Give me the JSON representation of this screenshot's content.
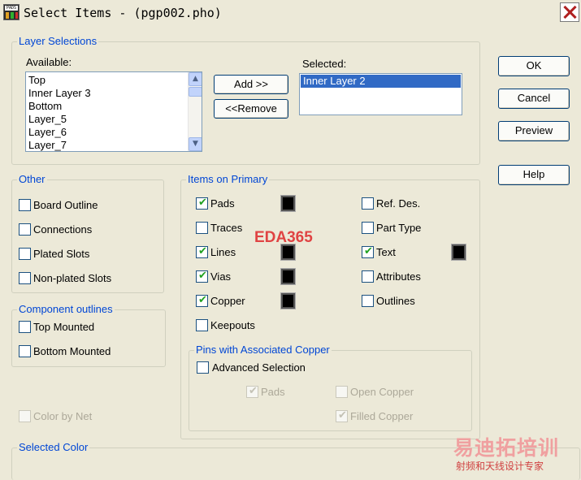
{
  "window": {
    "title": "Select Items - (pgp002.pho)"
  },
  "layer_selections": {
    "title": "Layer Selections",
    "available_label": "Available:",
    "available_items": [
      "Top",
      "Inner Layer 3",
      "Bottom",
      "Layer_5",
      "Layer_6",
      "Layer_7"
    ],
    "selected_label": "Selected:",
    "selected_items": [
      "Inner Layer 2"
    ],
    "add_button": "Add >>",
    "remove_button": "<<Remove"
  },
  "buttons": {
    "ok": "OK",
    "cancel": "Cancel",
    "preview": "Preview",
    "help": "Help"
  },
  "other": {
    "title": "Other",
    "items": [
      {
        "label": "Board Outline",
        "checked": false
      },
      {
        "label": "Connections",
        "checked": false
      },
      {
        "label": "Plated Slots",
        "checked": false
      },
      {
        "label": "Non-plated Slots",
        "checked": false
      }
    ]
  },
  "component_outlines": {
    "title": "Component outlines",
    "items": [
      {
        "label": "Top Mounted",
        "checked": false
      },
      {
        "label": "Bottom Mounted",
        "checked": false
      }
    ]
  },
  "color_by_net": {
    "label": "Color by Net",
    "checked": false,
    "enabled": false
  },
  "items_on_primary": {
    "title": "Items on Primary",
    "left": [
      {
        "label": "Pads",
        "checked": true,
        "color": "#000000"
      },
      {
        "label": "Traces",
        "checked": false
      },
      {
        "label": "Lines",
        "checked": true,
        "color": "#000000"
      },
      {
        "label": "Vias",
        "checked": true,
        "color": "#000000"
      },
      {
        "label": "Copper",
        "checked": true,
        "color": "#000000"
      },
      {
        "label": "Keepouts",
        "checked": false
      }
    ],
    "right": [
      {
        "label": "Ref. Des.",
        "checked": false
      },
      {
        "label": "Part Type",
        "checked": false
      },
      {
        "label": "Text",
        "checked": true,
        "color": "#000000"
      },
      {
        "label": "Attributes",
        "checked": false
      },
      {
        "label": "Outlines",
        "checked": false
      }
    ]
  },
  "pins_copper": {
    "title": "Pins with Associated Copper",
    "advanced_selection": {
      "label": "Advanced Selection",
      "checked": false
    },
    "pads": {
      "label": "Pads",
      "checked": true,
      "enabled": false
    },
    "open_copper": {
      "label": "Open Copper",
      "checked": false,
      "enabled": false
    },
    "filled_copper": {
      "label": "Filled Copper",
      "checked": true,
      "enabled": false
    }
  },
  "selected_color": {
    "title": "Selected Color"
  },
  "overlay": {
    "watermark": "EDA365",
    "logo_text": "易迪拓培训",
    "logo_sub": "射频和天线设计专家"
  }
}
